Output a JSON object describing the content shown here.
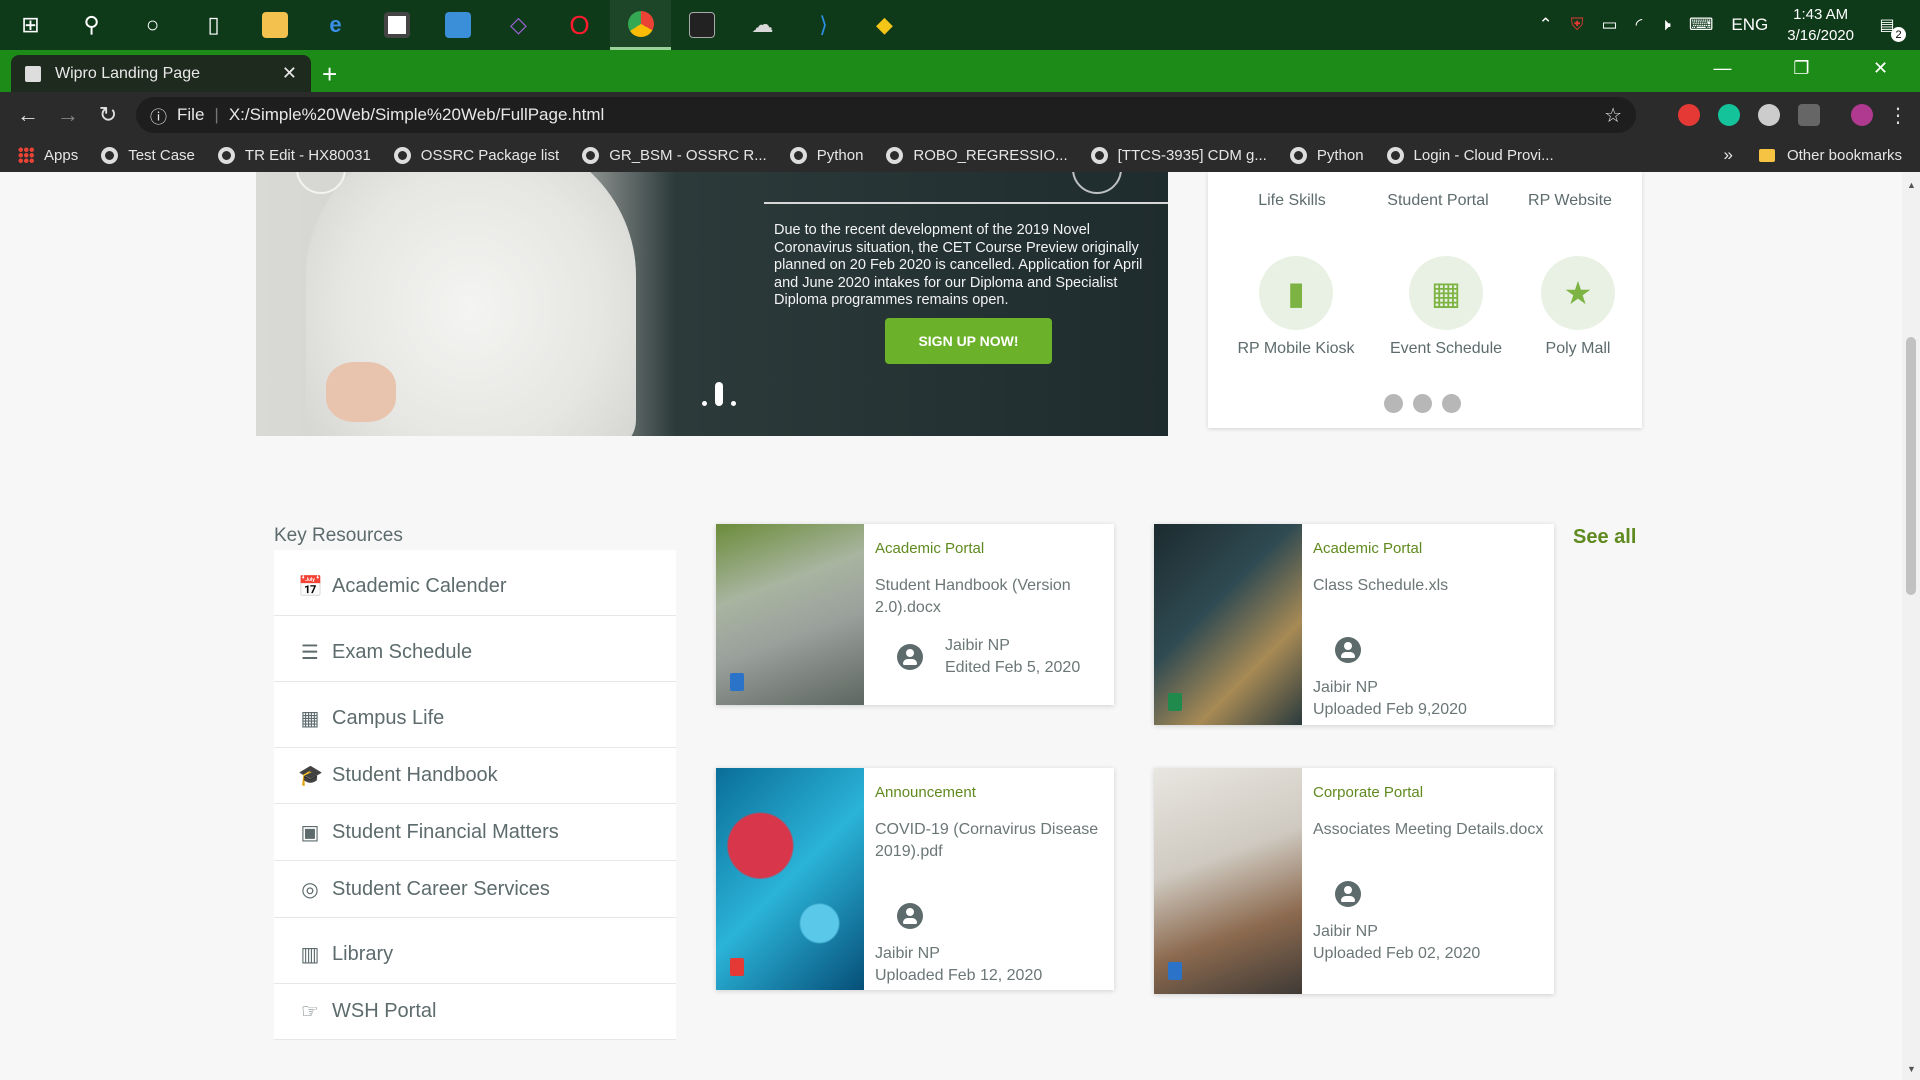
{
  "taskbar": {
    "icons": [
      "windows-start-icon",
      "search-icon",
      "cortana-icon",
      "task-view-icon",
      "file-explorer-icon",
      "edge-icon",
      "store-icon",
      "mail-icon",
      "visual-studio-icon",
      "opera-icon",
      "chrome-icon",
      "terminal-icon",
      "paint-icon",
      "vscode-icon",
      "git-icon"
    ],
    "language": "ENG",
    "time": "1:43 AM",
    "date": "3/16/2020",
    "notification_count": "2"
  },
  "browser": {
    "tab_title": "Wipro Landing Page",
    "url_scheme": "File",
    "url": "X:/Simple%20Web/Simple%20Web/FullPage.html",
    "bookmarks": [
      "Apps",
      "Test Case",
      "TR Edit - HX80031",
      "OSSRC Package list",
      "GR_BSM - OSSRC R...",
      "Python",
      "ROBO_REGRESSIO...",
      "[TTCS-3935] CDM g...",
      "Python",
      "Login - Cloud Provi..."
    ],
    "more_bookmarks": "»",
    "other_bookmarks": "Other bookmarks"
  },
  "hero": {
    "text": "Due to the recent development of the 2019 Novel Coronavirus situation, the CET Course Preview originally planned on 20 Feb 2020 is cancelled. Application for April and June 2020 intakes for our Diploma and Specialist Diploma programmes remains open.",
    "cta": "SIGN UP NOW!"
  },
  "quick_links": {
    "top_row": [
      "Life Skills",
      "Student Portal",
      "RP Website"
    ],
    "second_row": [
      {
        "label": "RP Mobile Kiosk",
        "icon": "mobile-kiosk-icon"
      },
      {
        "label": "Event Schedule",
        "icon": "calendar-icon"
      },
      {
        "label": "Poly Mall",
        "icon": "star-icon"
      }
    ],
    "accent": "#7cb342"
  },
  "key_resources": {
    "title": "Key Resources",
    "items": [
      {
        "label": "Academic Calender",
        "icon": "calendar-icon"
      },
      {
        "label": "Exam Schedule",
        "icon": "checklist-icon"
      },
      {
        "label": "Campus Life",
        "icon": "building-icon"
      },
      {
        "label": "Student Handbook",
        "icon": "graduation-cap-icon"
      },
      {
        "label": "Student Financial Matters",
        "icon": "money-icon"
      },
      {
        "label": "Student Career Services",
        "icon": "compass-icon"
      },
      {
        "label": "Library",
        "icon": "books-icon"
      },
      {
        "label": "WSH Portal",
        "icon": "hand-point-icon"
      }
    ]
  },
  "documents": {
    "see_all": "See all",
    "cards": [
      {
        "category": "Academic Portal",
        "file": "Student Handbook (Version 2.0).docx",
        "author": "Jaibir NP",
        "status": "Edited Feb 5, 2020"
      },
      {
        "category": "Academic Portal",
        "file": "Class Schedule.xls",
        "author": "Jaibir NP",
        "status": "Uploaded Feb 9,2020"
      },
      {
        "category": "Announcement",
        "file": "COVID-19 (Cornavirus Disease 2019).pdf",
        "author": "Jaibir NP",
        "status": "Uploaded Feb 12, 2020"
      },
      {
        "category": "Corporate Portal",
        "file": "Associates Meeting Details.docx",
        "author": "Jaibir NP",
        "status": "Uploaded Feb 02, 2020"
      }
    ]
  }
}
